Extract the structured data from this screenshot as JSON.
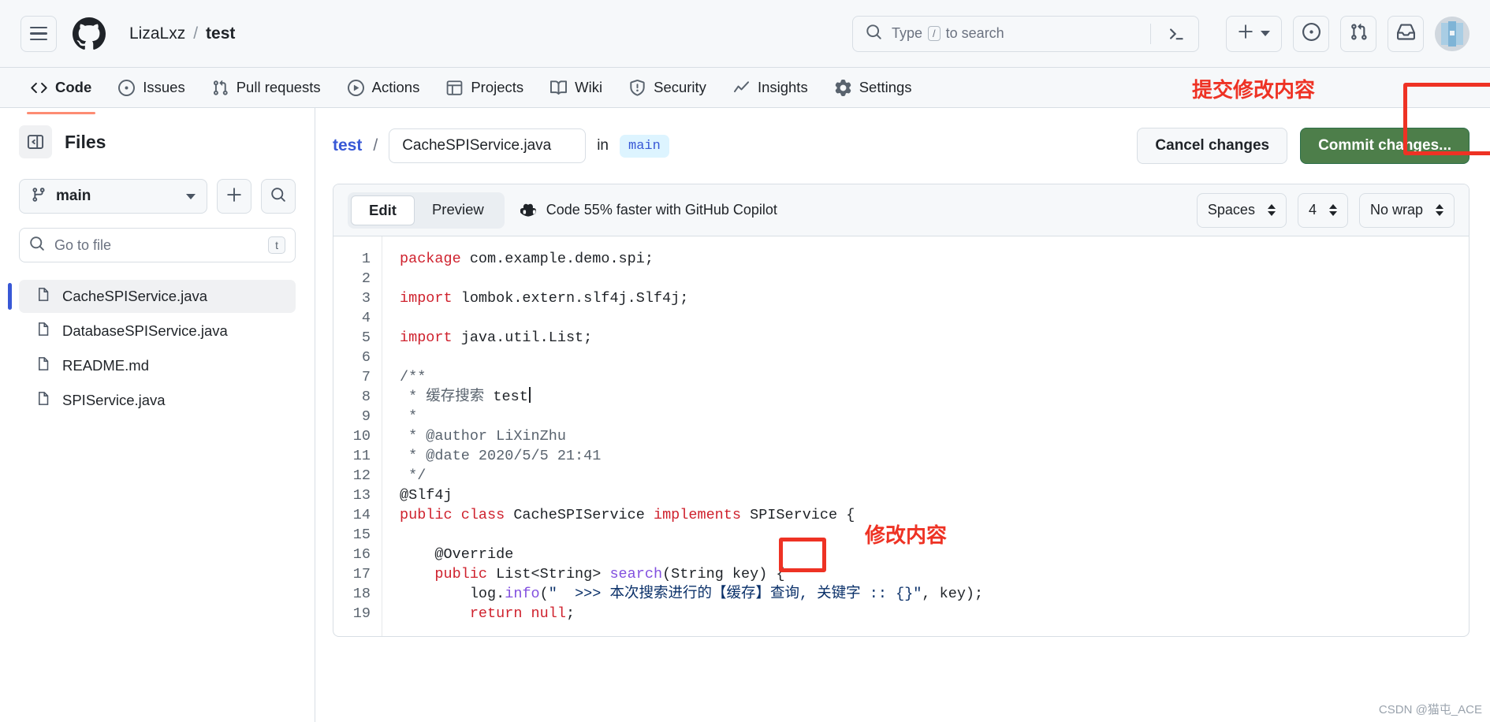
{
  "header": {
    "owner": "LizaLxz",
    "separator": "/",
    "repo": "test",
    "search_placeholder": "Type",
    "search_slash": "/",
    "search_placeholder_tail": "to search",
    "icons": {
      "menu": "hamburger-icon",
      "logo": "github-logo-icon",
      "search": "search-icon",
      "terminal": "terminal-icon",
      "plus": "plus-icon",
      "caret": "chevron-down-icon",
      "issues": "issue-opened-icon",
      "pulls": "git-pull-request-icon",
      "inbox": "inbox-icon",
      "avatar": "avatar"
    }
  },
  "repo_nav": {
    "items": [
      {
        "label": "Code",
        "icon": "code-icon",
        "active": true
      },
      {
        "label": "Issues",
        "icon": "issue-opened-icon",
        "active": false
      },
      {
        "label": "Pull requests",
        "icon": "git-pull-request-icon",
        "active": false
      },
      {
        "label": "Actions",
        "icon": "play-icon",
        "active": false
      },
      {
        "label": "Projects",
        "icon": "table-icon",
        "active": false
      },
      {
        "label": "Wiki",
        "icon": "book-icon",
        "active": false
      },
      {
        "label": "Security",
        "icon": "shield-icon",
        "active": false
      },
      {
        "label": "Insights",
        "icon": "graph-icon",
        "active": false
      },
      {
        "label": "Settings",
        "icon": "gear-icon",
        "active": false
      }
    ]
  },
  "annotations": {
    "top_right": "提交修改内容",
    "middle": "修改内容",
    "color": "#ee3224"
  },
  "sidebar": {
    "title": "Files",
    "toggle_icon": "sidebar-collapse-icon",
    "branch": "main",
    "branch_icon": "git-branch-icon",
    "new_icon": "plus-icon",
    "search_icon": "search-icon",
    "go_to_file_placeholder": "Go to file",
    "go_to_file_kbd": "t",
    "files": [
      {
        "name": "CacheSPIService.java",
        "selected": true
      },
      {
        "name": "DatabaseSPIService.java",
        "selected": false
      },
      {
        "name": "README.md",
        "selected": false
      },
      {
        "name": "SPIService.java",
        "selected": false
      }
    ]
  },
  "file_path": {
    "repo": "test",
    "slash": "/",
    "filename": "CacheSPIService.java",
    "in_word": "in",
    "branch": "main"
  },
  "actions": {
    "cancel": "Cancel changes",
    "commit": "Commit changes...",
    "commit_color": "#4d7e4a"
  },
  "editor_toolbar": {
    "tabs": [
      {
        "label": "Edit",
        "active": true
      },
      {
        "label": "Preview",
        "active": false
      }
    ],
    "copilot_text": "Code 55% faster with GitHub Copilot",
    "copilot_icon": "copilot-icon",
    "indent_mode": "Spaces",
    "indent_size": "4",
    "wrap_mode": "No wrap"
  },
  "code": {
    "lines": [
      {
        "n": "1",
        "segments": [
          {
            "t": "package ",
            "c": "kw"
          },
          {
            "t": "com.example.demo.spi;",
            "c": "plain"
          }
        ]
      },
      {
        "n": "2",
        "segments": []
      },
      {
        "n": "3",
        "segments": [
          {
            "t": "import ",
            "c": "kw"
          },
          {
            "t": "lombok.extern.slf4j.Slf4j;",
            "c": "plain"
          }
        ]
      },
      {
        "n": "4",
        "segments": []
      },
      {
        "n": "5",
        "segments": [
          {
            "t": "import ",
            "c": "kw"
          },
          {
            "t": "java.util.List;",
            "c": "plain"
          }
        ]
      },
      {
        "n": "6",
        "segments": []
      },
      {
        "n": "7",
        "segments": [
          {
            "t": "/**",
            "c": "cmt"
          }
        ]
      },
      {
        "n": "8",
        "segments": [
          {
            "t": " * 缓存搜索",
            "c": "cmt"
          },
          {
            "t": " test",
            "c": "edit"
          }
        ]
      },
      {
        "n": "9",
        "segments": [
          {
            "t": " *",
            "c": "cmt"
          }
        ]
      },
      {
        "n": "10",
        "segments": [
          {
            "t": " * @author LiXinZhu",
            "c": "cmt"
          }
        ]
      },
      {
        "n": "11",
        "segments": [
          {
            "t": " * @date 2020/5/5 21:41",
            "c": "cmt"
          }
        ]
      },
      {
        "n": "12",
        "segments": [
          {
            "t": " */",
            "c": "cmt"
          }
        ]
      },
      {
        "n": "13",
        "segments": [
          {
            "t": "@Slf4j",
            "c": "plain"
          }
        ]
      },
      {
        "n": "14",
        "segments": [
          {
            "t": "public class ",
            "c": "kw"
          },
          {
            "t": "CacheSPIService ",
            "c": "plain"
          },
          {
            "t": "implements ",
            "c": "kw"
          },
          {
            "t": "SPIService {",
            "c": "plain"
          }
        ]
      },
      {
        "n": "15",
        "segments": []
      },
      {
        "n": "16",
        "segments": [
          {
            "t": "    @Override",
            "c": "plain"
          }
        ]
      },
      {
        "n": "17",
        "segments": [
          {
            "t": "    public ",
            "c": "kw"
          },
          {
            "t": "List<String> ",
            "c": "plain"
          },
          {
            "t": "search",
            "c": "fn"
          },
          {
            "t": "(String ",
            "c": "plain"
          },
          {
            "t": "key",
            "c": "plain"
          },
          {
            "t": ") {",
            "c": "plain"
          }
        ]
      },
      {
        "n": "18",
        "segments": [
          {
            "t": "        log.",
            "c": "plain"
          },
          {
            "t": "info",
            "c": "fn"
          },
          {
            "t": "(",
            "c": "plain"
          },
          {
            "t": "\"  >>> 本次搜索进行的【缓存】查询, 关键字 :: {}\"",
            "c": "str"
          },
          {
            "t": ", key);",
            "c": "plain"
          }
        ]
      },
      {
        "n": "19",
        "segments": [
          {
            "t": "        return ",
            "c": "kw"
          },
          {
            "t": "null",
            "c": "kw"
          },
          {
            "t": ";",
            "c": "plain"
          }
        ]
      }
    ]
  },
  "watermark": "CSDN @猫屯_ACE"
}
